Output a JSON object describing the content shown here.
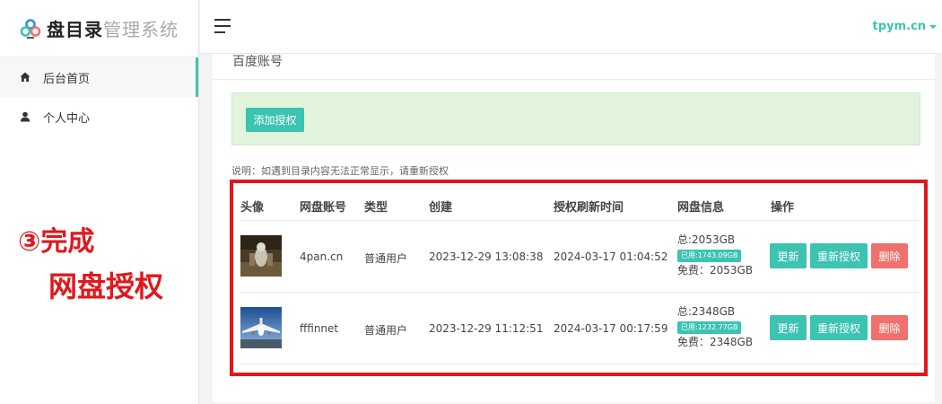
{
  "app": {
    "logo_main": "盘目录",
    "logo_sub": "管理系统",
    "user": "tpym.cn"
  },
  "sidebar": {
    "items": [
      {
        "label": "后台首页",
        "icon": "home-icon"
      },
      {
        "label": "个人中心",
        "icon": "user-icon"
      }
    ]
  },
  "panel": {
    "title": "百度账号",
    "add_button": "添加授权",
    "hint": "说明：如遇到目录内容无法正常显示，请重新授权"
  },
  "table": {
    "headers": [
      "头像",
      "网盘账号",
      "类型",
      "创建",
      "授权刷新时间",
      "网盘信息",
      "操作"
    ],
    "rows": [
      {
        "account": "4pan.cn",
        "type": "普通用户",
        "created": "2023-12-29 13:08:38",
        "refreshed": "2024-03-17 01:04:52",
        "total": "总:2053GB",
        "used": "已用:1743.09GB",
        "free": "免费：2053GB"
      },
      {
        "account": "fffinnet",
        "type": "普通用户",
        "created": "2023-12-29 11:12:51",
        "refreshed": "2024-03-17 00:17:59",
        "total": "总:2348GB",
        "used": "已用:1232.77GB",
        "free": "免费：2348GB"
      }
    ],
    "actions": {
      "update": "更新",
      "reauth": "重新授权",
      "delete": "删除"
    }
  },
  "annotation": {
    "line1": "③完成",
    "line2": "网盘授权"
  },
  "colors": {
    "accent": "#3cc3b1",
    "danger": "#f0706d",
    "annotation": "#e0181d",
    "notice_bg": "#e2f4db"
  }
}
